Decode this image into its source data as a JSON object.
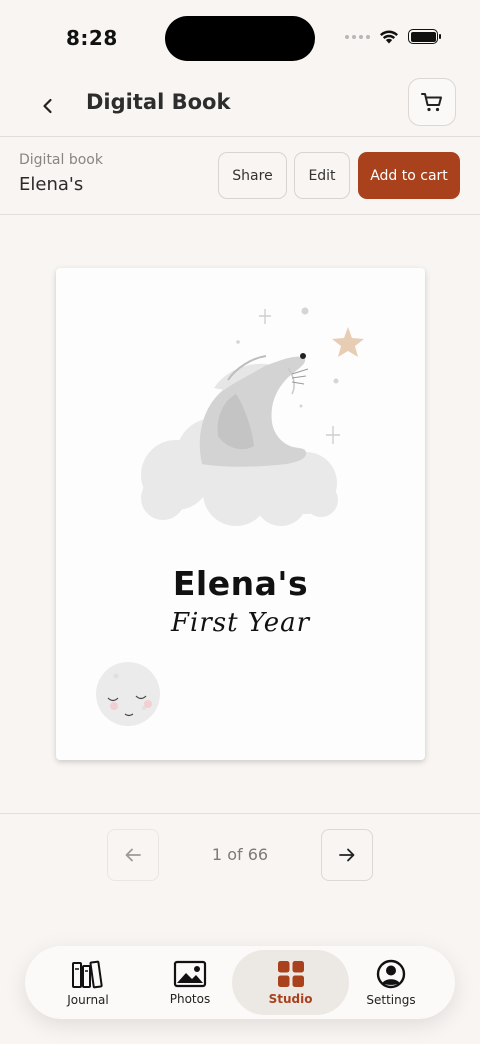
{
  "status_bar": {
    "time": "8:28"
  },
  "header": {
    "title": "Digital Book"
  },
  "book_bar": {
    "subtitle": "Digital book",
    "name": "Elena's",
    "share_label": "Share",
    "edit_label": "Edit",
    "add_to_cart_label": "Add to cart"
  },
  "book_page": {
    "title": "Elena's",
    "subtitle": "First Year"
  },
  "pager": {
    "indicator": "1 of 66"
  },
  "tab_bar": {
    "tabs": [
      {
        "label": "Journal",
        "icon": "books-icon"
      },
      {
        "label": "Photos",
        "icon": "image-icon"
      },
      {
        "label": "Studio",
        "icon": "grid-icon",
        "active": true
      },
      {
        "label": "Settings",
        "icon": "user-circle-icon"
      }
    ]
  },
  "colors": {
    "accent": "#a9421c",
    "background": "#f8f5f2",
    "star": "#e8cdb5"
  }
}
